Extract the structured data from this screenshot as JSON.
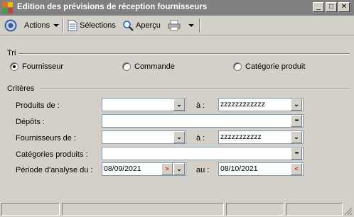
{
  "window": {
    "title": "Edition des prévisions de réception fournisseurs",
    "buttons": {
      "minimize": "_",
      "maximize": "□",
      "close": "✕"
    }
  },
  "toolbar": {
    "actions_label": "Actions",
    "selections_label": "Sélections",
    "preview_label": "Aperçu"
  },
  "sort": {
    "heading": "Tri",
    "options": [
      {
        "label": "Fournisseur",
        "checked": true
      },
      {
        "label": "Commande",
        "checked": false
      },
      {
        "label": "Catégorie produit",
        "checked": false
      }
    ]
  },
  "criteria": {
    "heading": "Critères",
    "products_from": {
      "label": "Produits de :",
      "from_value": "",
      "to_label": "à :",
      "to_value": "zzzzzzzzzzzz"
    },
    "depots": {
      "label": "Dépôts :",
      "value": ""
    },
    "suppliers_from": {
      "label": "Fournisseurs de :",
      "from_value": "",
      "to_label": "à :",
      "to_value": "zzzzzzzzzzz"
    },
    "product_categories": {
      "label": "Catégories produits :",
      "value": ""
    },
    "period": {
      "label": "Période d'analyse du :",
      "from_value": "08/09/2021",
      "to_label": "au :",
      "to_value": "08/10/2021"
    }
  },
  "glyphs": {
    "double_down": "❯❯",
    "ellipsis": "•••",
    "arrow_right": ">",
    "arrow_left": "<",
    "down": "⌄"
  },
  "colors": {
    "titlebar": "#808080",
    "face": "#d4d0c8",
    "field_border": "#7f9db9",
    "accent_red": "#cc3300",
    "accent_blue": "#2b5fb8"
  }
}
